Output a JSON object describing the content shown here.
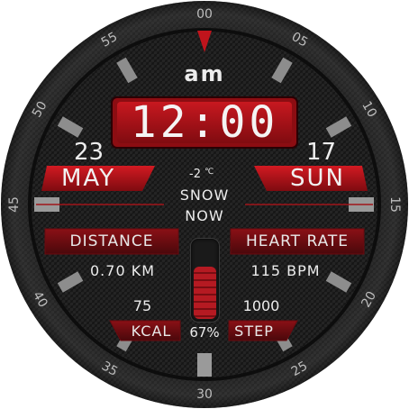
{
  "colors": {
    "accent_red": "#c0141c",
    "dial_dark": "#1b1b1b",
    "text_light": "#ececec"
  },
  "bezel": {
    "labels": [
      "00",
      "05",
      "10",
      "15",
      "20",
      "25",
      "30",
      "35",
      "40",
      "45",
      "50",
      "55"
    ]
  },
  "time": {
    "ampm": "am",
    "display": "12:00"
  },
  "date": {
    "day_number": "23",
    "month": "MAY",
    "weekday_number": "17",
    "weekday": "SUN"
  },
  "weather": {
    "temperature": "-2",
    "unit": "℃",
    "condition_line1": "SNOW",
    "condition_line2": "NOW"
  },
  "stats": {
    "distance_label": "DISTANCE",
    "distance_value": "0.70 KM",
    "heart_rate_label": "HEART RATE",
    "heart_rate_value": "115 BPM",
    "kcal_value": "75",
    "kcal_label": "KCAL",
    "step_value": "1000",
    "step_label": "STEP"
  },
  "battery": {
    "percent_text": "67%",
    "level": 0.67
  }
}
